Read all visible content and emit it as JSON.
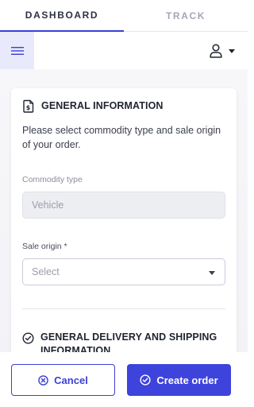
{
  "tabs": [
    {
      "label": "DASHBOARD",
      "active": true
    },
    {
      "label": "TRACK",
      "active": false
    }
  ],
  "toolbar": {
    "menu_icon": "hamburger-icon",
    "user_icon": "user-icon",
    "user_dropdown_icon": "caret-down-icon"
  },
  "general_information": {
    "title": "GENERAL INFORMATION",
    "icon": "document-dollar-icon",
    "description": "Please select commodity type and sale origin of your order.",
    "commodity_type": {
      "label": "Commodity type",
      "value": "Vehicle",
      "disabled": true
    },
    "sale_origin": {
      "label": "Sale origin *",
      "placeholder": "Select"
    }
  },
  "delivery_section": {
    "title": "GENERAL DELIVERY AND SHIPPING INFORMATION",
    "icon": "check-circle-icon"
  },
  "footer": {
    "cancel_label": "Cancel",
    "cancel_icon": "x-circle-icon",
    "create_label": "Create order",
    "create_icon": "check-circle-icon"
  },
  "colors": {
    "accent": "#3e43dc",
    "menu_bg": "#e8e9fb",
    "page_bg": "#f5f5f8"
  }
}
